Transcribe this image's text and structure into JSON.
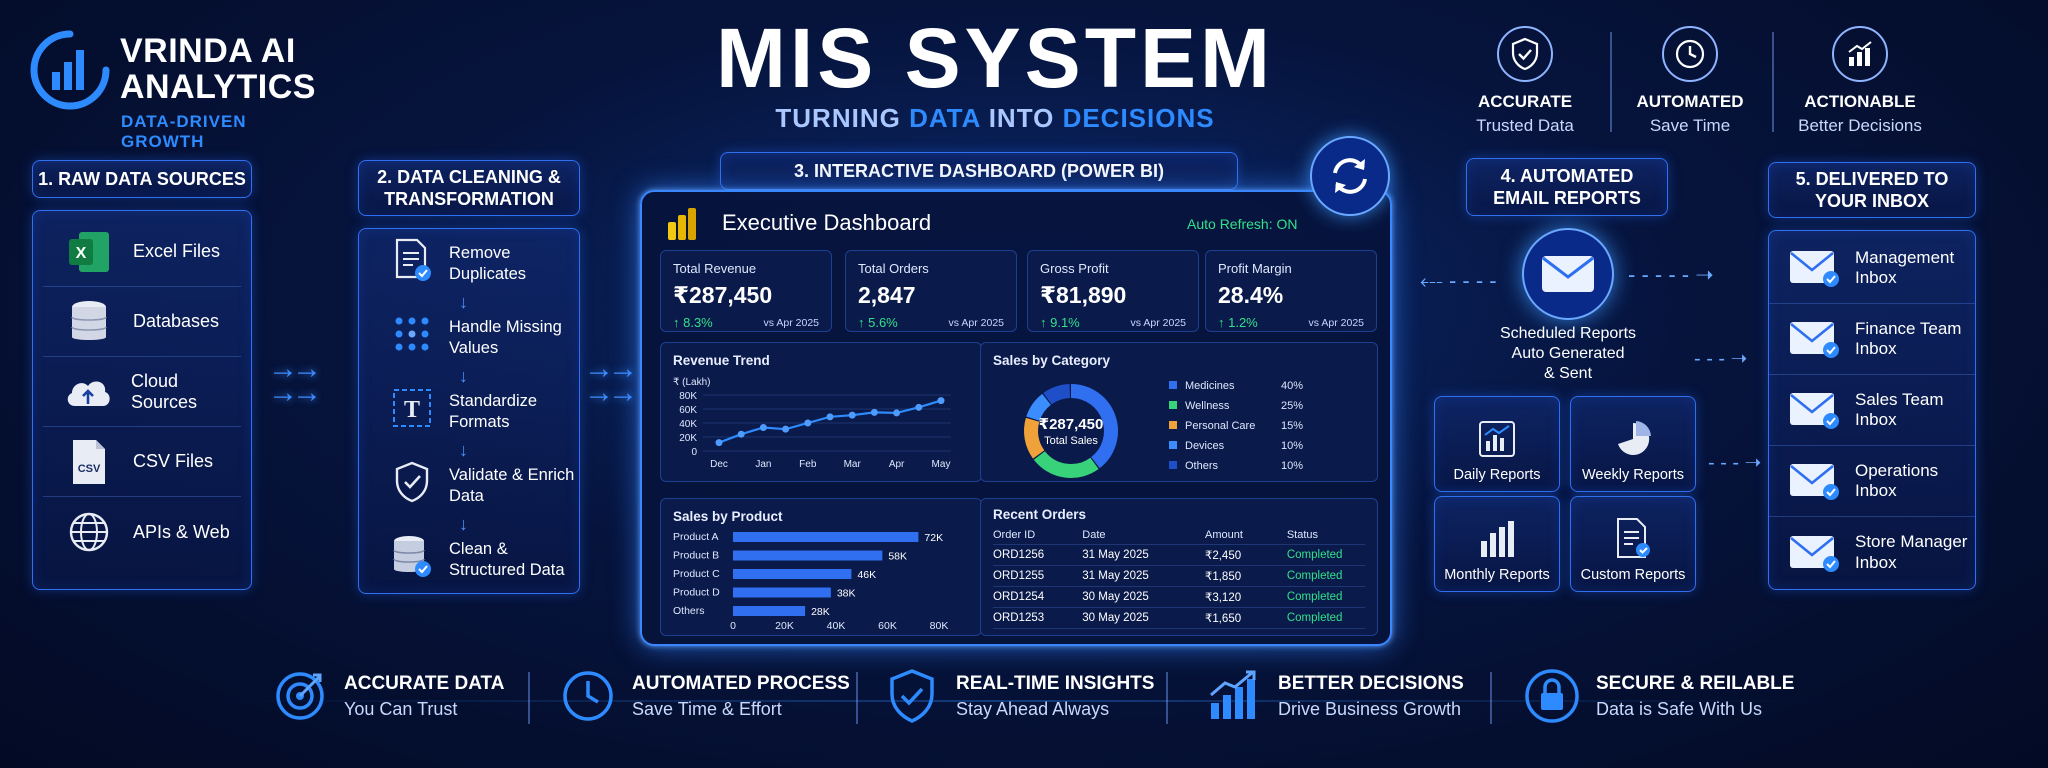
{
  "brand": {
    "name_line1": "VRINDA AI",
    "name_line2": "ANALYTICS",
    "tagline": "DATA-DRIVEN GROWTH"
  },
  "header": {
    "title": "MIS SYSTEM",
    "subtitle_part1": "TURNING",
    "subtitle_hl1": "DATA",
    "subtitle_part2": "INTO",
    "subtitle_hl2": "DECISIONS"
  },
  "top_features": [
    {
      "icon": "shield-check-icon",
      "title": "ACCURATE",
      "subtitle": "Trusted Data"
    },
    {
      "icon": "clock-icon",
      "title": "AUTOMATED",
      "subtitle": "Save Time"
    },
    {
      "icon": "chart-up-icon",
      "title": "ACTIONABLE",
      "subtitle": "Better Decisions"
    }
  ],
  "steps": {
    "raw": {
      "title": "1. RAW DATA SOURCES",
      "items": [
        "Excel Files",
        "Databases",
        "Cloud Sources",
        "CSV Files",
        "APIs & Web"
      ]
    },
    "cleaning": {
      "title": "2. DATA CLEANING & TRANSFORMATION",
      "items": [
        "Remove Duplicates",
        "Handle Missing Values",
        "Standardize Formats",
        "Validate & Enrich Data",
        "Clean & Structured Data"
      ]
    },
    "dashboard": {
      "title": "3. INTERACTIVE DASHBOARD (POWER BI)"
    },
    "email": {
      "title": "4. AUTOMATED EMAIL REPORTS",
      "caption_line1": "Scheduled Reports",
      "caption_line2": "Auto Generated",
      "caption_line3": "& Sent",
      "reports": [
        "Daily Reports",
        "Weekly Reports",
        "Monthly Reports",
        "Custom Reports"
      ]
    },
    "inbox": {
      "title": "5. DELIVERED TO YOUR INBOX",
      "items": [
        {
          "line1": "Management",
          "line2": "Inbox"
        },
        {
          "line1": "Finance Team",
          "line2": "Inbox"
        },
        {
          "line1": "Sales Team",
          "line2": "Inbox"
        },
        {
          "line1": "Operations",
          "line2": "Inbox"
        },
        {
          "line1": "Store Manager",
          "line2": "Inbox"
        }
      ]
    }
  },
  "dashboard": {
    "title": "Executive Dashboard",
    "auto_refresh": "Auto Refresh: ON",
    "kpis": [
      {
        "label": "Total Revenue",
        "value": "₹287,450",
        "change": "↑ 8.3%",
        "vs": "vs Apr 2025"
      },
      {
        "label": "Total Orders",
        "value": "2,847",
        "change": "↑ 5.6%",
        "vs": "vs Apr 2025"
      },
      {
        "label": "Gross Profit",
        "value": "₹81,890",
        "change": "↑ 9.1%",
        "vs": "vs Apr 2025"
      },
      {
        "label": "Profit Margin",
        "value": "28.4%",
        "change": "↑ 1.2%",
        "vs": "vs Apr 2025"
      }
    ],
    "recent_orders": {
      "title": "Recent Orders",
      "headers": [
        "Order ID",
        "Date",
        "Amount",
        "Status"
      ],
      "rows": [
        [
          "ORD1256",
          "31 May 2025",
          "₹2,450",
          "Completed"
        ],
        [
          "ORD1255",
          "31 May 2025",
          "₹1,850",
          "Completed"
        ],
        [
          "ORD1254",
          "30 May 2025",
          "₹3,120",
          "Completed"
        ],
        [
          "ORD1253",
          "30 May 2025",
          "₹1,650",
          "Completed"
        ]
      ]
    }
  },
  "chart_data": [
    {
      "type": "line",
      "title": "Revenue Trend",
      "ylabel": "₹ (Lakh)",
      "x": [
        "Dec",
        "Jan",
        "Feb",
        "Mar",
        "Apr",
        "May"
      ],
      "x_points": [
        "Dec",
        "",
        "Jan",
        "",
        "Feb",
        "",
        "Mar",
        "",
        "Apr",
        "",
        "May"
      ],
      "values": [
        15,
        30,
        42,
        39,
        50,
        61,
        64,
        69,
        68,
        78,
        90
      ],
      "yticks": [
        "0",
        "20K",
        "40K",
        "60K",
        "80K"
      ],
      "ylim": [
        0,
        100
      ]
    },
    {
      "type": "pie",
      "title": "Sales by Category",
      "center_value": "₹287,450",
      "center_label": "Total Sales",
      "categories": [
        "Medicines",
        "Wellness",
        "Personal Care",
        "Devices",
        "Others"
      ],
      "values": [
        40,
        25,
        15,
        10,
        10
      ],
      "labels": [
        "40%",
        "25%",
        "15%",
        "10%",
        "10%"
      ],
      "colors": [
        "#2f6ff0",
        "#38d27a",
        "#f0a23a",
        "#3b8cff",
        "#1f4fc8"
      ]
    },
    {
      "type": "bar",
      "title": "Sales by Product",
      "categories": [
        "Product A",
        "Product B",
        "Product C",
        "Product D",
        "Others"
      ],
      "values": [
        72,
        58,
        46,
        38,
        28
      ],
      "labels": [
        "72K",
        "58K",
        "46K",
        "38K",
        "28K"
      ],
      "xticks": [
        "0",
        "20K",
        "40K",
        "60K",
        "80K"
      ],
      "xlim": [
        0,
        80
      ]
    }
  ],
  "bottom_features": [
    {
      "icon": "target-icon",
      "title": "ACCURATE DATA",
      "subtitle": "You Can Trust"
    },
    {
      "icon": "clock-icon",
      "title": "AUTOMATED PROCESS",
      "subtitle": "Save Time & Effort"
    },
    {
      "icon": "shield-check-icon",
      "title": "REAL-TIME INSIGHTS",
      "subtitle": "Stay Ahead Always"
    },
    {
      "icon": "bar-chart-up-icon",
      "title": "BETTER DECISIONS",
      "subtitle": "Drive Business Growth"
    },
    {
      "icon": "lock-icon",
      "title": "SECURE & REILABLE",
      "subtitle": "Data is Safe With Us"
    }
  ],
  "colors": {
    "accent": "#2e8bff",
    "positive": "#33e08a",
    "background": "#06143d"
  }
}
